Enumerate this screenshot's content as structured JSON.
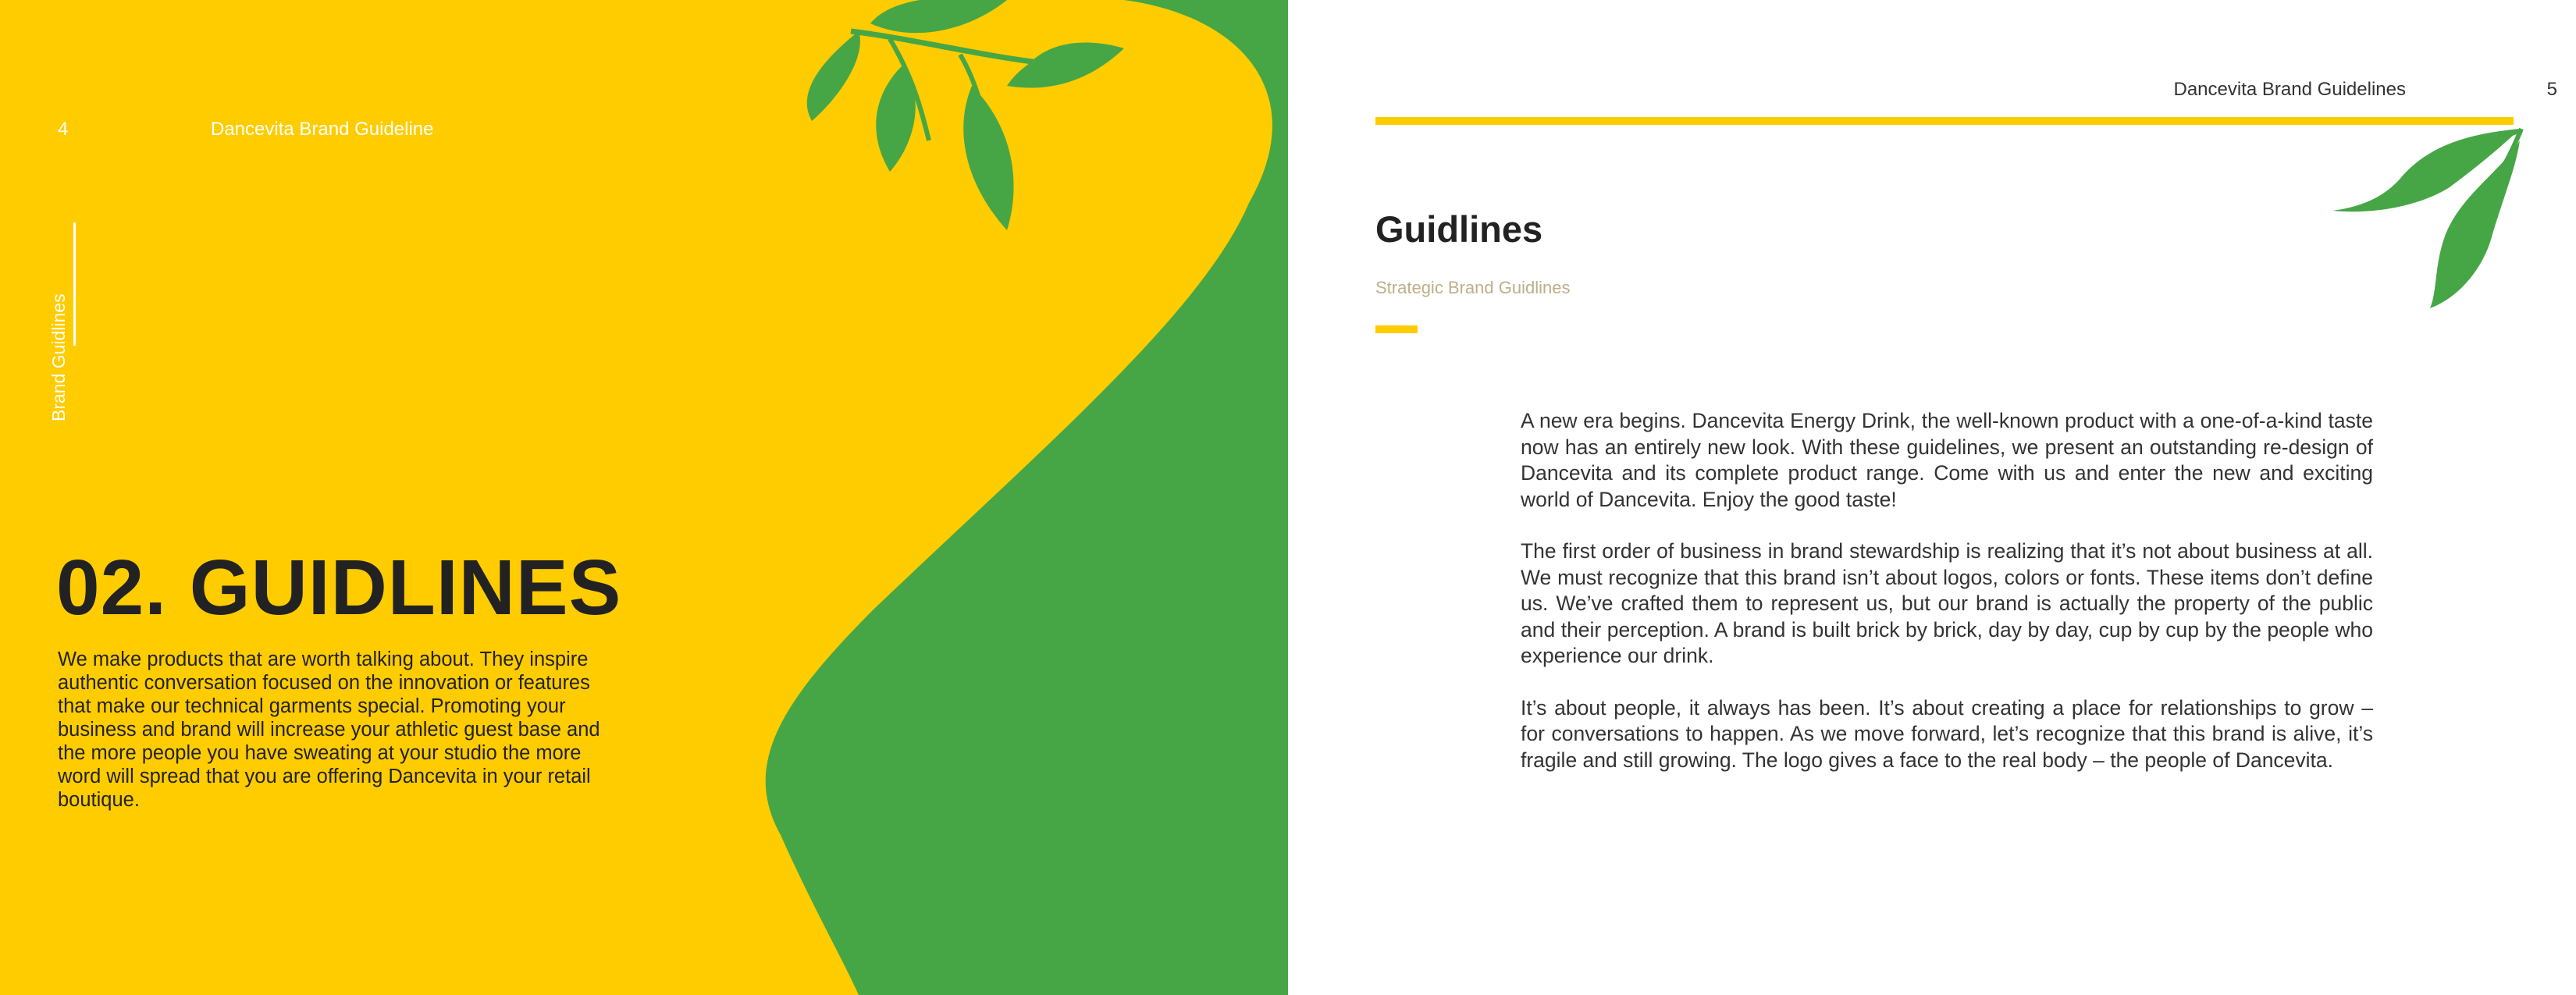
{
  "left_page": {
    "page_number": "4",
    "running_header": "Dancevita Brand Guideline",
    "vertical_label": "Brand Guidlines",
    "title": "02. GUIDLINES",
    "intro": "We make products that are worth talking about. They inspire authentic conversation focused on the innovation or features that make our technical garments special. Promoting your business and brand will increase your athletic guest base and the more people you have sweating at your studio the more word will spread that you are offering Dancevita in your retail boutique."
  },
  "right_page": {
    "running_header": "Dancevita Brand Guidelines",
    "page_number": "5",
    "section_title": "Guidlines",
    "subtitle": "Strategic Brand Guidlines",
    "paragraphs": [
      "A new era begins. Dancevita Energy Drink, the well-known product with a one-of-a-kind taste now has an entirely new look. With these guidelines, we present an outstanding re-design of Dancevita and its complete product range. Come with us and enter the new and exciting world of Dancevita. Enjoy the good taste!",
      "The first order of business in brand stewardship is realizing that it’s not about business at all. We must recognize that this brand isn’t about logos, colors or fonts. These items don’t define us. We’ve crafted them to represent us, but our brand is actually the property of the public and their perception.  A brand is built brick by brick, day by day, cup by cup by the people who experience our drink.",
      "It’s about people, it always has been. It’s about creating a place for relationships to grow – for conversations to happen. As we move forward, let’s recognize that this brand is alive, it’s fragile and still growing. The logo gives a face to the real body – the people of Dancevita."
    ]
  },
  "colors": {
    "yellow": "#FFCC00",
    "green": "#46A646",
    "text_dark": "#222222",
    "subtitle_tan": "#BFAE87"
  }
}
